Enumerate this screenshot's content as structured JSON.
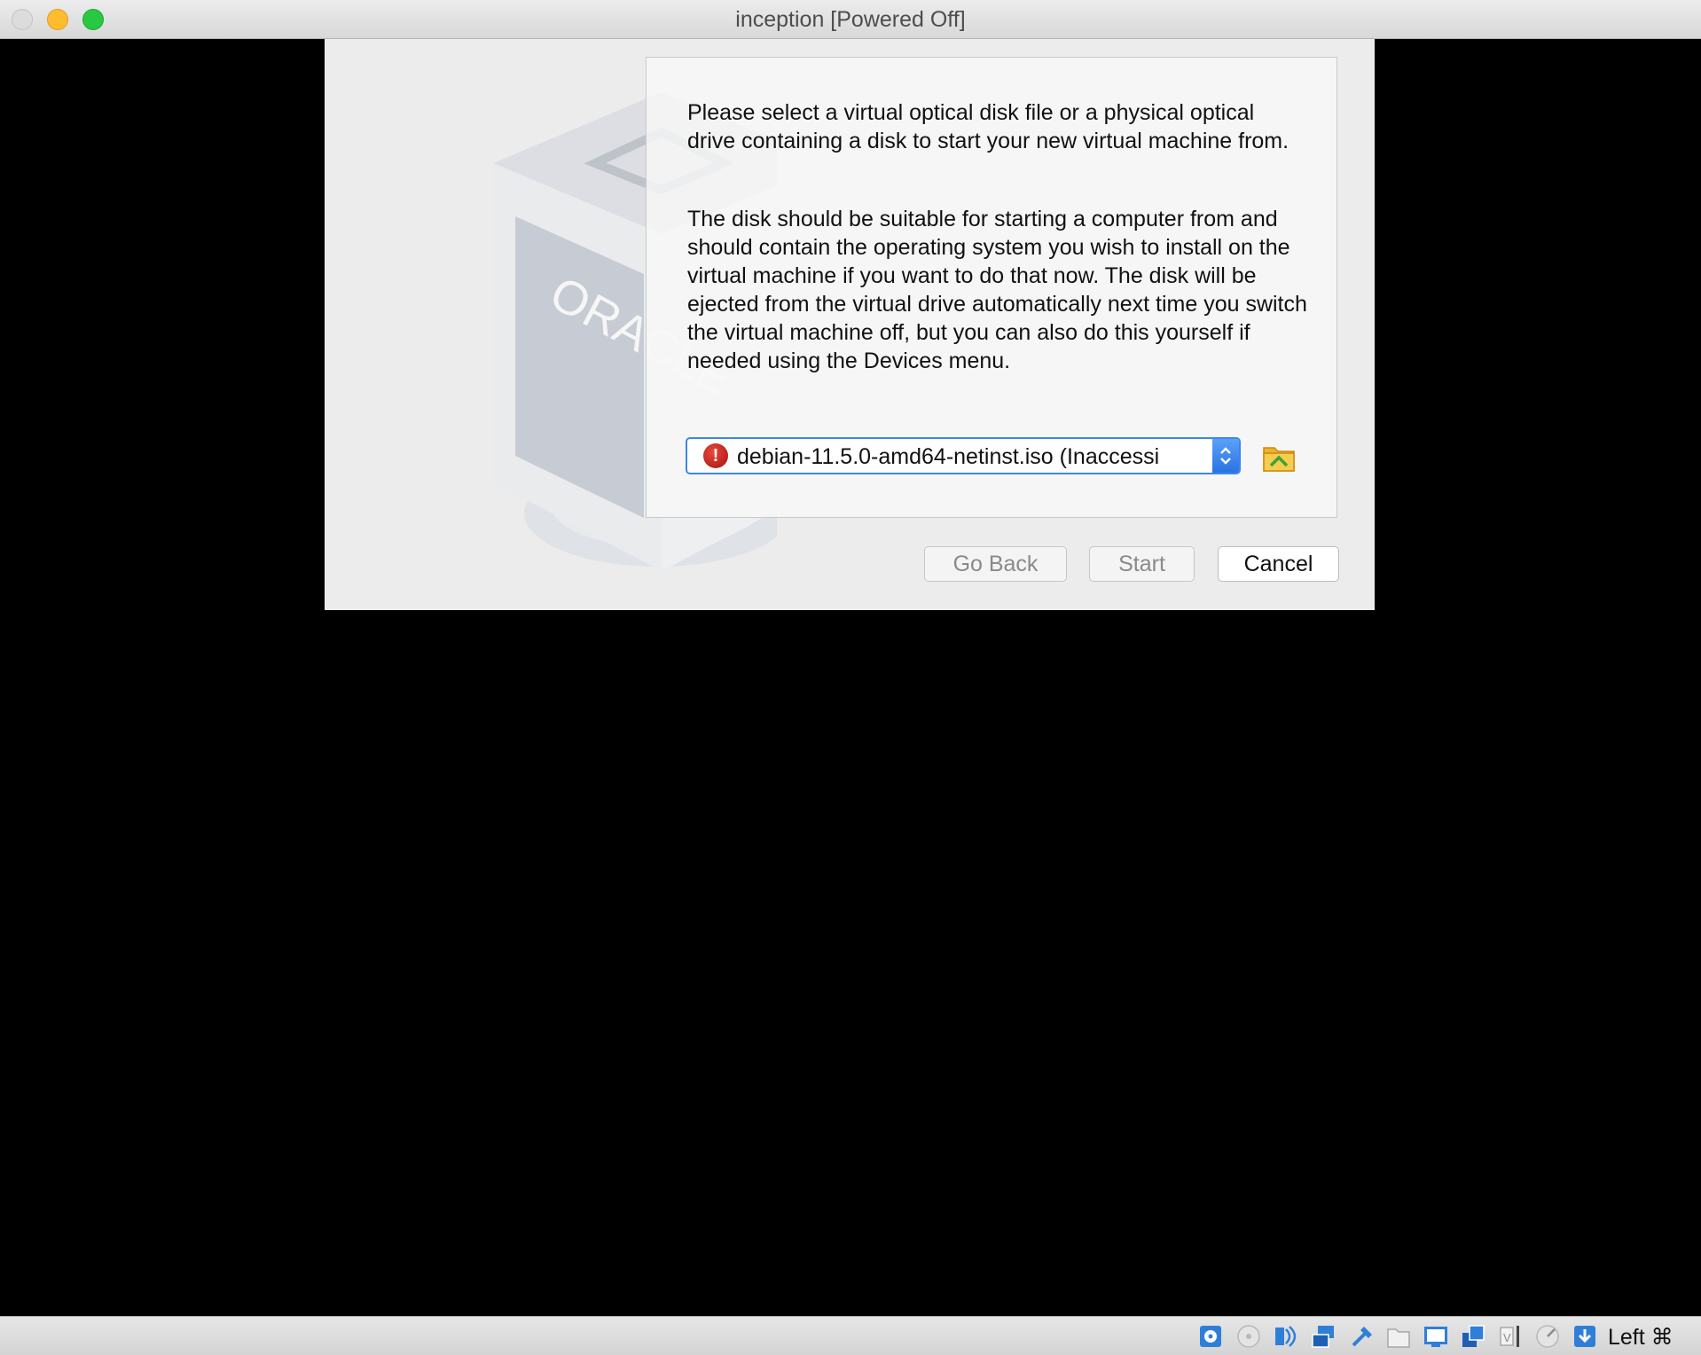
{
  "window": {
    "title": "inception [Powered Off]"
  },
  "wizard": {
    "paragraph1": "Please select a virtual optical disk file or a physical optical drive containing a disk to start your new virtual machine from.",
    "paragraph2": "The disk should be suitable for starting a computer from and should contain the operating system you wish to install on the virtual machine if you want to do that now. The disk will be ejected from the virtual drive automatically next time you switch the virtual machine off, but you can also do this yourself if needed using the Devices menu.",
    "watermark_text": "ORACLE",
    "disk_selector": {
      "selected": "debian-11.5.0-amd64-netinst.iso (Inaccessi",
      "status_icon": "error-icon",
      "status_glyph": "!"
    },
    "buttons": {
      "go_back": "Go Back",
      "start": "Start",
      "cancel": "Cancel"
    }
  },
  "statusbar": {
    "icons": [
      "hard-disk-icon",
      "optical-disk-icon",
      "audio-icon",
      "network-icon",
      "usb-icon",
      "shared-folders-icon",
      "display-icon",
      "video-capture-icon",
      "recording-icon",
      "cpu-icon",
      "mouse-integration-icon"
    ],
    "host_key": "Left ⌘"
  },
  "colors": {
    "accent": "#3b86f0",
    "error": "#c8201a",
    "background": "#000000"
  }
}
